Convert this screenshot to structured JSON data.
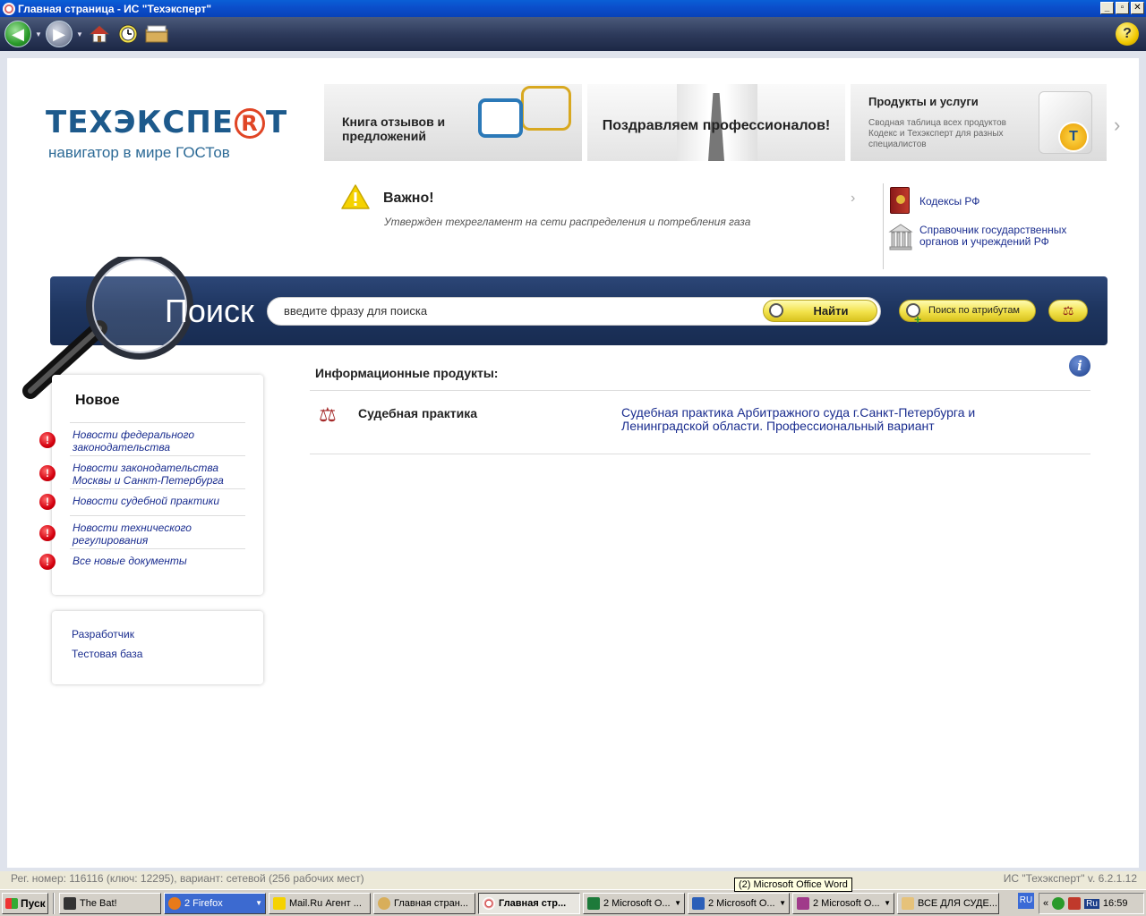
{
  "window": {
    "title": "Главная страница - ИС \"Техэксперт\"",
    "minimize": "_",
    "maximize": "▫",
    "close": "✕"
  },
  "toolbar": {
    "help": "?"
  },
  "logo": {
    "main_before": "ТЕХЭКСПЕ",
    "main_r": "R",
    "main_after": "Т",
    "subtitle": "навигатор в мире ГОСТов"
  },
  "banners": {
    "feedback": "Книга отзывов и предложений",
    "congrats": "Поздравляем профессионалов!",
    "products_title": "Продукты и услуги",
    "products_desc": "Сводная таблица всех продуктов Кодекс и Техэксперт для разных специалистов"
  },
  "important": {
    "title": "Важно!",
    "text": "Утвержден техрегламент на сети распределения и потребления газа"
  },
  "side_links": {
    "codes": "Кодексы РФ",
    "directory": "Справочник государственных органов и учреждений РФ"
  },
  "search": {
    "title": "Поиск",
    "placeholder": "введите фразу для поиска",
    "find": "Найти",
    "by_attributes": "Поиск по атрибутам"
  },
  "news": {
    "title": "Новое",
    "items": [
      "Новости федерального законодательства",
      "Новости законодательства Москвы и Санкт-Петербурга",
      "Новости судебной практики",
      "Новости технического регулирования",
      "Все новые документы"
    ]
  },
  "dev_panel": {
    "developer": "Разработчик",
    "test_db": "Тестовая база"
  },
  "products": {
    "heading": "Информационные продукты:",
    "items": [
      {
        "name": "Судебная практика",
        "link": "Судебная практика Арбитражного суда г.Санкт-Петербурга и Ленинградской области. Профессиональный вариант"
      }
    ]
  },
  "status": {
    "left": "Рег. номер: 116116 (ключ: 12295), вариант: сетевой (256 рабочих мест)",
    "right": "ИС \"Техэксперт\" v. 6.2.1.12",
    "tooltip": "(2) Microsoft Office Word"
  },
  "taskbar": {
    "start": "Пуск",
    "tasks": [
      "The Bat!",
      "2 Firefox",
      "Mail.Ru Агент ...",
      "Главная стран...",
      "Главная стр...",
      "2 Microsoft O...",
      "2 Microsoft O...",
      "2 Microsoft O...",
      "ВСЕ ДЛЯ СУДЕ..."
    ],
    "lang": "RU",
    "tray_lang": "Ru",
    "clock": "16:59",
    "chevron": "«"
  }
}
